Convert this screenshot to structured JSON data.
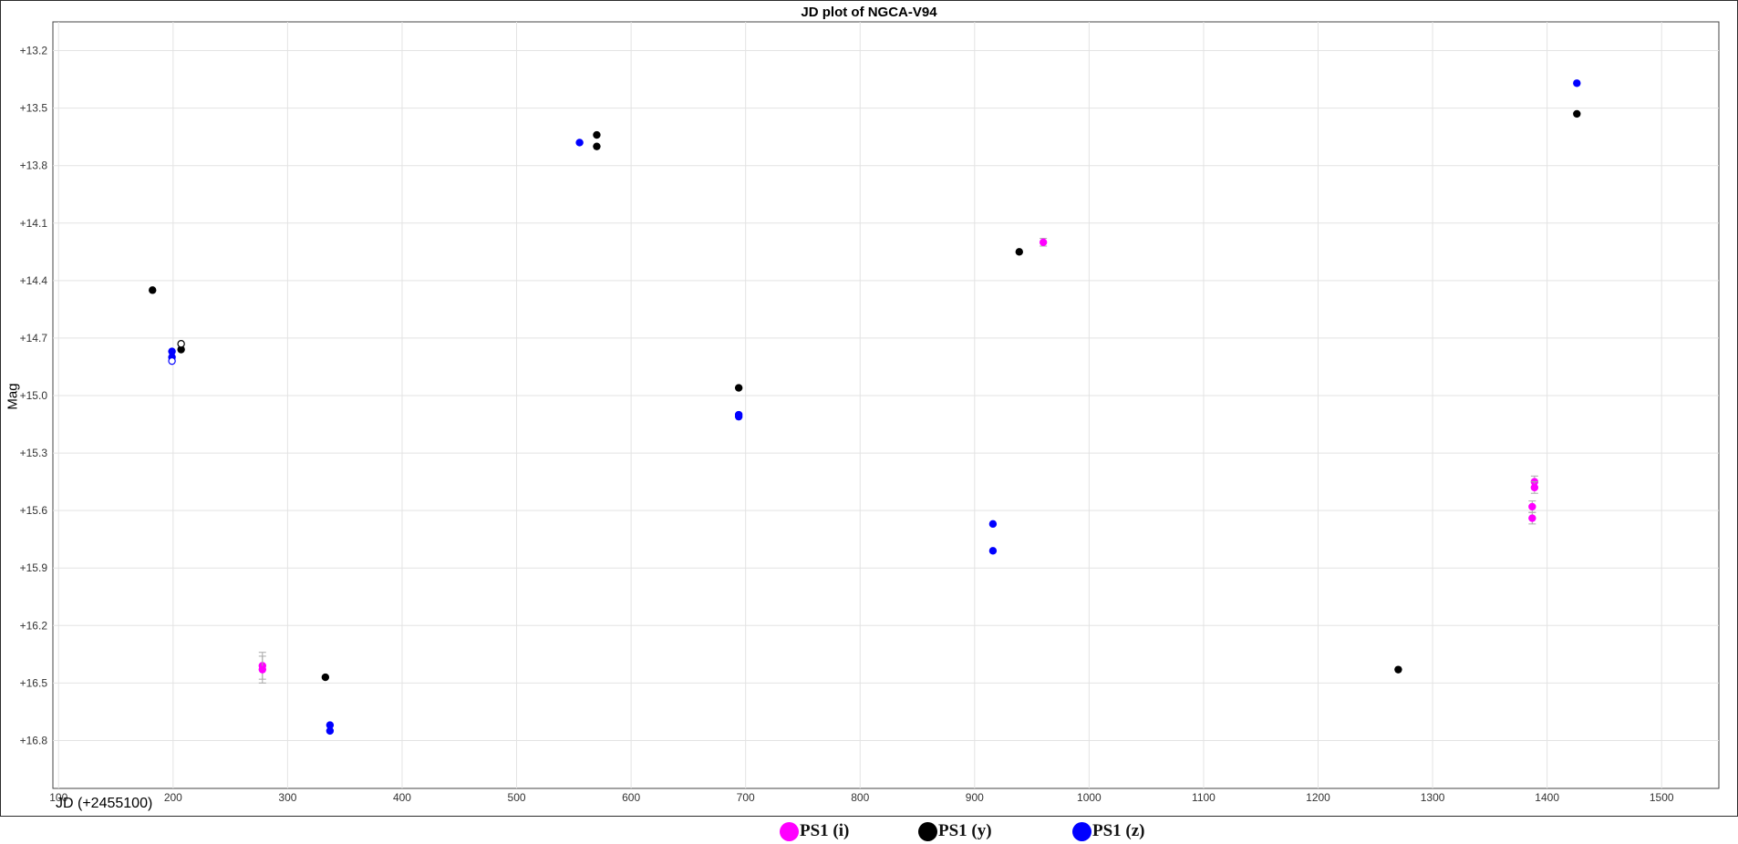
{
  "chart_data": {
    "type": "scatter",
    "title": "JD plot of NGCA-V94",
    "xlabel": "JD (+2455100)",
    "ylabel": "Mag",
    "xlim": [
      95,
      1550
    ],
    "ylim": [
      13.05,
      17.05
    ],
    "y_inverted": true,
    "grid": true,
    "legend_position": "bottom-center",
    "x_ticks": [
      100,
      200,
      300,
      400,
      500,
      600,
      700,
      800,
      900,
      1000,
      1100,
      1200,
      1300,
      1400,
      1500
    ],
    "x_tick_labels": [
      "100",
      "200",
      "300",
      "400",
      "500",
      "600",
      "700",
      "800",
      "900",
      "1000",
      "1100",
      "1200",
      "1300",
      "1400",
      "1500"
    ],
    "y_ticks": [
      13.2,
      13.5,
      13.8,
      14.1,
      14.4,
      14.7,
      15.0,
      15.3,
      15.6,
      15.9,
      16.2,
      16.5,
      16.8
    ],
    "y_tick_labels": [
      "+13.2",
      "+13.5",
      "+13.8",
      "+14.1",
      "+14.4",
      "+14.7",
      "+15.0",
      "+15.3",
      "+15.6",
      "+15.9",
      "+16.2",
      "+16.5",
      "+16.8"
    ],
    "series": [
      {
        "name": "PS1 (i)",
        "color": "#ff00ff",
        "points": [
          {
            "x": 278,
            "y": 16.41,
            "err": 0.07
          },
          {
            "x": 278,
            "y": 16.43,
            "err": 0.07
          },
          {
            "x": 960,
            "y": 14.2,
            "err": 0.02
          },
          {
            "x": 1387,
            "y": 15.58,
            "err": 0.03
          },
          {
            "x": 1387,
            "y": 15.64,
            "err": 0.03
          },
          {
            "x": 1389,
            "y": 15.45,
            "err": 0.03
          },
          {
            "x": 1389,
            "y": 15.48,
            "err": 0.03
          }
        ]
      },
      {
        "name": "PS1 (y)",
        "color": "#000000",
        "points": [
          {
            "x": 182,
            "y": 14.45
          },
          {
            "x": 207,
            "y": 14.76
          },
          {
            "x": 207,
            "y": 14.73,
            "hollow": true
          },
          {
            "x": 333,
            "y": 16.47
          },
          {
            "x": 570,
            "y": 13.64
          },
          {
            "x": 570,
            "y": 13.7
          },
          {
            "x": 694,
            "y": 14.96
          },
          {
            "x": 939,
            "y": 14.25
          },
          {
            "x": 1270,
            "y": 16.43
          },
          {
            "x": 1426,
            "y": 13.53
          }
        ]
      },
      {
        "name": "PS1 (z)",
        "color": "#0000ff",
        "points": [
          {
            "x": 199,
            "y": 14.77
          },
          {
            "x": 199,
            "y": 14.8
          },
          {
            "x": 199,
            "y": 14.82,
            "hollow": true
          },
          {
            "x": 337,
            "y": 16.72
          },
          {
            "x": 337,
            "y": 16.75
          },
          {
            "x": 555,
            "y": 13.68
          },
          {
            "x": 694,
            "y": 15.1
          },
          {
            "x": 694,
            "y": 15.11
          },
          {
            "x": 916,
            "y": 15.67
          },
          {
            "x": 916,
            "y": 15.81
          },
          {
            "x": 1426,
            "y": 13.37
          }
        ]
      }
    ]
  }
}
